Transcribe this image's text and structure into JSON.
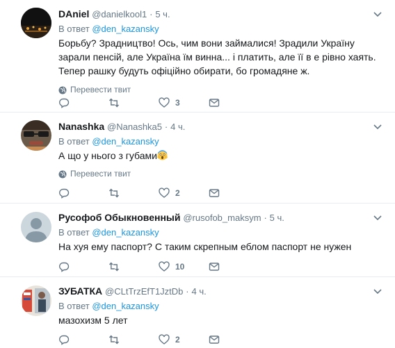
{
  "reply_prefix": "В ответ",
  "translate_label": "Перевести твит",
  "tweets": [
    {
      "name": "DAniel",
      "handle": "@danielkool1",
      "time": "5 ч.",
      "mention": "@den_kazansky",
      "text": "Борьбу? Зрадництво! Ось, чим вони займалися! Зрадили Україну зарали пенсій, але Україна їм винна... і платить, але її в е рівно хаять. Тепер рашку будуть офіційно обирати, бо громадяне ж.",
      "reply_count": "",
      "retweet_count": "",
      "like_count": "3"
    },
    {
      "name": "Nanashka",
      "handle": "@Nanashka5",
      "time": "4 ч.",
      "mention": "@den_kazansky",
      "text": "А що у нього з губами",
      "reply_count": "",
      "retweet_count": "",
      "like_count": "2"
    },
    {
      "name": "Русофоб Обыкновенный",
      "handle": "@rusofob_maksym",
      "time": "5 ч.",
      "mention": "@den_kazansky",
      "text": "На хуя ему паспорт? С таким скрепным еблом паспорт не нужен",
      "reply_count": "",
      "retweet_count": "",
      "like_count": "10"
    },
    {
      "name": "ЗУБАТКА",
      "handle": "@CLtTrzEfT1JztDb",
      "time": "4 ч.",
      "mention": "@den_kazansky",
      "text": "мазохизм 5 лет",
      "reply_count": "",
      "retweet_count": "",
      "like_count": "2"
    }
  ]
}
